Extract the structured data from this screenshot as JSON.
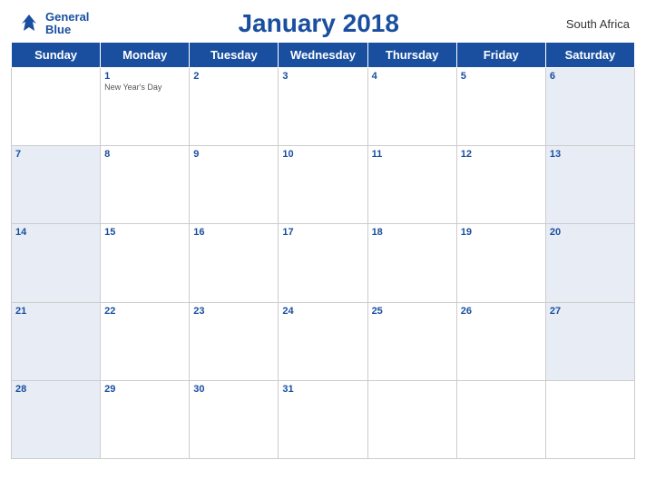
{
  "header": {
    "logo_line1": "General",
    "logo_line2": "Blue",
    "title": "January 2018",
    "country": "South Africa"
  },
  "days_of_week": [
    "Sunday",
    "Monday",
    "Tuesday",
    "Wednesday",
    "Thursday",
    "Friday",
    "Saturday"
  ],
  "weeks": [
    [
      {
        "num": "",
        "holiday": "",
        "type": "empty"
      },
      {
        "num": "1",
        "holiday": "New Year's Day",
        "type": "weekday"
      },
      {
        "num": "2",
        "holiday": "",
        "type": "weekday"
      },
      {
        "num": "3",
        "holiday": "",
        "type": "weekday"
      },
      {
        "num": "4",
        "holiday": "",
        "type": "weekday"
      },
      {
        "num": "5",
        "holiday": "",
        "type": "weekday"
      },
      {
        "num": "6",
        "holiday": "",
        "type": "saturday"
      }
    ],
    [
      {
        "num": "7",
        "holiday": "",
        "type": "sunday"
      },
      {
        "num": "8",
        "holiday": "",
        "type": "weekday"
      },
      {
        "num": "9",
        "holiday": "",
        "type": "weekday"
      },
      {
        "num": "10",
        "holiday": "",
        "type": "weekday"
      },
      {
        "num": "11",
        "holiday": "",
        "type": "weekday"
      },
      {
        "num": "12",
        "holiday": "",
        "type": "weekday"
      },
      {
        "num": "13",
        "holiday": "",
        "type": "saturday"
      }
    ],
    [
      {
        "num": "14",
        "holiday": "",
        "type": "sunday"
      },
      {
        "num": "15",
        "holiday": "",
        "type": "weekday"
      },
      {
        "num": "16",
        "holiday": "",
        "type": "weekday"
      },
      {
        "num": "17",
        "holiday": "",
        "type": "weekday"
      },
      {
        "num": "18",
        "holiday": "",
        "type": "weekday"
      },
      {
        "num": "19",
        "holiday": "",
        "type": "weekday"
      },
      {
        "num": "20",
        "holiday": "",
        "type": "saturday"
      }
    ],
    [
      {
        "num": "21",
        "holiday": "",
        "type": "sunday"
      },
      {
        "num": "22",
        "holiday": "",
        "type": "weekday"
      },
      {
        "num": "23",
        "holiday": "",
        "type": "weekday"
      },
      {
        "num": "24",
        "holiday": "",
        "type": "weekday"
      },
      {
        "num": "25",
        "holiday": "",
        "type": "weekday"
      },
      {
        "num": "26",
        "holiday": "",
        "type": "weekday"
      },
      {
        "num": "27",
        "holiday": "",
        "type": "saturday"
      }
    ],
    [
      {
        "num": "28",
        "holiday": "",
        "type": "sunday"
      },
      {
        "num": "29",
        "holiday": "",
        "type": "weekday"
      },
      {
        "num": "30",
        "holiday": "",
        "type": "weekday"
      },
      {
        "num": "31",
        "holiday": "",
        "type": "weekday"
      },
      {
        "num": "",
        "holiday": "",
        "type": "empty"
      },
      {
        "num": "",
        "holiday": "",
        "type": "empty"
      },
      {
        "num": "",
        "holiday": "",
        "type": "empty"
      }
    ]
  ],
  "colors": {
    "header_bg": "#1a4fa0",
    "header_text": "#ffffff",
    "weekend_bg": "#e8edf5",
    "title_color": "#1a4fa0"
  }
}
